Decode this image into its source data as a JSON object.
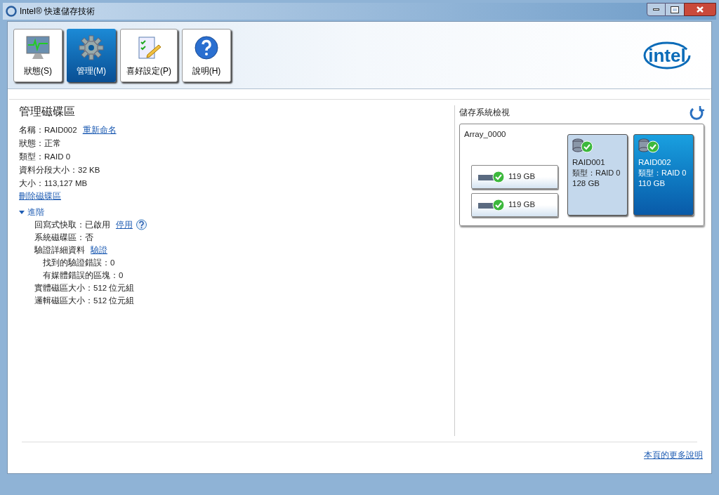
{
  "window": {
    "title": "Intel® 快速儲存技術"
  },
  "tabs": [
    {
      "label": "狀態(S)",
      "selected": false
    },
    {
      "label": "管理(M)",
      "selected": true
    },
    {
      "label": "喜好設定(P)",
      "selected": false
    },
    {
      "label": "說明(H)",
      "selected": false
    }
  ],
  "logo": "intel",
  "volume_panel": {
    "title": "管理磁碟區",
    "details": [
      {
        "text": "名稱：RAID002",
        "link": "重新命名"
      },
      {
        "text": "狀態：正常"
      },
      {
        "text": "類型：RAID 0"
      },
      {
        "text": "資料分段大小：32 KB"
      },
      {
        "text": "大小：113,127 MB"
      }
    ],
    "delete_link": "刪除磁碟區",
    "advanced": {
      "label": "進階",
      "expanded": true,
      "items": [
        {
          "text": "回寫式快取：已啟用",
          "link": "停用",
          "help": true
        },
        {
          "text": "系統磁碟區：否"
        },
        {
          "text": "驗證詳細資料",
          "link": "驗證",
          "children": [
            {
              "text": "找到的驗證錯誤：0"
            },
            {
              "text": "有媒體錯誤的區塊：0"
            }
          ]
        },
        {
          "text": "實體磁區大小：512 位元組"
        },
        {
          "text": "邏輯磁區大小：512 位元組"
        }
      ]
    }
  },
  "storage_view": {
    "title": "儲存系統檢視",
    "array": "Array_0000",
    "disks": [
      {
        "size": "119 GB"
      },
      {
        "size": "119 GB"
      }
    ],
    "volumes": [
      {
        "name": "RAID001",
        "type": "類型：RAID 0",
        "size": "128 GB",
        "selected": false
      },
      {
        "name": "RAID002",
        "type": "類型：RAID 0",
        "size": "110 GB",
        "selected": true
      }
    ]
  },
  "footer_link": "本頁的更多說明"
}
